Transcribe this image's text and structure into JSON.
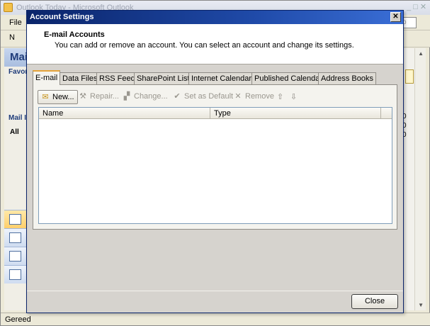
{
  "background_window": {
    "title": "Outlook Today - Microsoft Outlook",
    "menu_file": "File",
    "toolbar_new": "N",
    "nav_header": "Mai",
    "favorites_label": "Favor",
    "mail_label": "Mail I",
    "all_label": "All",
    "status_text": "Gereed",
    "help_box": "p",
    "side_numbers": [
      "0",
      "0",
      "0"
    ]
  },
  "dialog": {
    "title": "Account Settings",
    "close_glyph": "✕",
    "header_title": "E-mail Accounts",
    "header_description": "You can add or remove an account. You can select an account and change its settings.",
    "tabs": [
      {
        "label": "E-mail",
        "active": true
      },
      {
        "label": "Data Files",
        "active": false
      },
      {
        "label": "RSS Feeds",
        "active": false
      },
      {
        "label": "SharePoint Lists",
        "active": false
      },
      {
        "label": "Internet Calendars",
        "active": false
      },
      {
        "label": "Published Calendars",
        "active": false
      },
      {
        "label": "Address Books",
        "active": false
      }
    ],
    "toolbar": {
      "new_label": "New...",
      "repair_label": "Repair...",
      "change_label": "Change...",
      "set_default_label": "Set as Default",
      "remove_label": "Remove",
      "new_icon": "new-account-icon",
      "repair_icon": "tools-icon",
      "change_icon": "change-icon",
      "set_default_icon": "check-circle-icon",
      "remove_icon": "x-icon",
      "move_up_icon": "arrow-up-icon",
      "move_down_icon": "arrow-down-icon"
    },
    "list": {
      "columns": [
        "Name",
        "Type"
      ],
      "rows": []
    },
    "close_button_label": "Close"
  },
  "colors": {
    "titlebar": "#0a246a",
    "active_tab_accent": "#e5a33a",
    "dialog_body": "#d6d3ce"
  }
}
